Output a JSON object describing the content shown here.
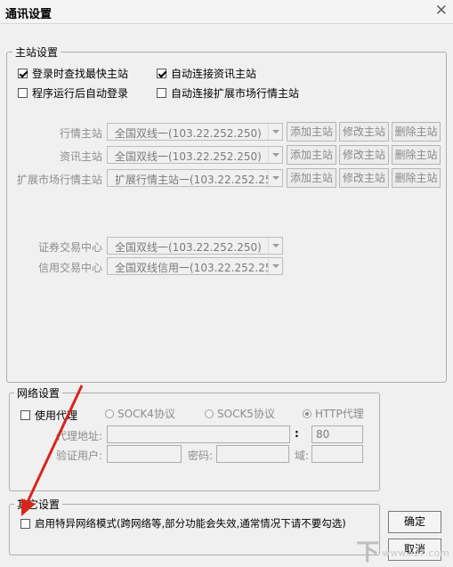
{
  "window": {
    "title": "通讯设置",
    "close_glyph": "✕"
  },
  "main_station": {
    "legend": "主站设置",
    "checkboxes": [
      {
        "label": "登录时查找最快主站",
        "checked": true
      },
      {
        "label": "自动连接资讯主站",
        "checked": true
      },
      {
        "label": "程序运行后自动登录",
        "checked": false
      },
      {
        "label": "自动连接扩展市场行情主站",
        "checked": false
      }
    ],
    "rows": [
      {
        "label": "行情主站",
        "value": "全国双线一(103.22.252.250)"
      },
      {
        "label": "资讯主站",
        "value": "全国双线一(103.22.252.250)"
      },
      {
        "label": "扩展市场行情主站",
        "value": "扩展行情主站一(103.22.252.25"
      }
    ],
    "buttons": {
      "add": "添加主站",
      "edit": "修改主站",
      "delete": "删除主站"
    },
    "trade_rows": [
      {
        "label": "证券交易中心",
        "value": "全国双线一(103.22.252.250)"
      },
      {
        "label": "信用交易中心",
        "value": "全国双线信用一(103.22.252.25"
      }
    ]
  },
  "network": {
    "legend": "网络设置",
    "use_proxy": {
      "label": "使用代理",
      "checked": false
    },
    "protocols": [
      {
        "label": "SOCK4协议",
        "selected": false
      },
      {
        "label": "SOCK5协议",
        "selected": false
      },
      {
        "label": "HTTP代理",
        "selected": true
      }
    ],
    "proxy_address_label": "代理地址:",
    "colon": ":",
    "port_value": "80",
    "auth_user_label": "验证用户:",
    "password_label": "密码:",
    "domain_label": "域:"
  },
  "other": {
    "legend": "其它设置",
    "special_mode": {
      "label": "启用特异网络模式(跨网络等,部分功能会失效,通常情况下请不要勾选)",
      "checked": false
    }
  },
  "actions": {
    "ok": "确定",
    "cancel": "取消"
  },
  "watermark": {
    "glyph": "下",
    "text": "www.xz7.com"
  },
  "colors": {
    "annotation_arrow": "#d9241c"
  }
}
